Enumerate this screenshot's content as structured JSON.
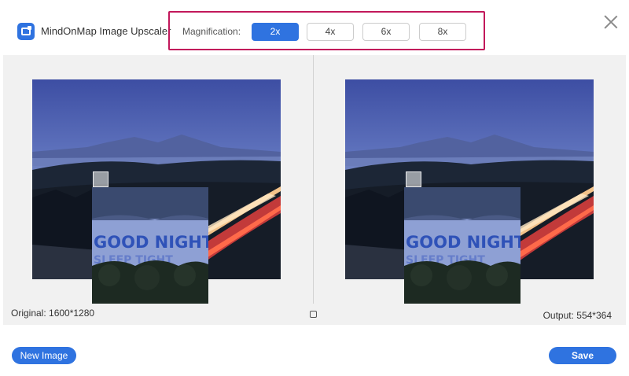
{
  "header": {
    "app_title": "MindOnMap Image Upscaler",
    "magnification_label": "Magnification:",
    "magnification_options": [
      "2x",
      "4x",
      "6x",
      "8x"
    ],
    "selected_magnification": "2x"
  },
  "preview": {
    "original_info": "Original: 1600*1280",
    "output_info": "Output: 554*364",
    "sign_text_line1": "GOOD NIGHT",
    "sign_text_line2": "SLEEP TIGHT"
  },
  "footer": {
    "new_image_label": "New Image",
    "save_label": "Save"
  },
  "colors": {
    "accent": "#2f73e0",
    "highlight_border": "#c2185b",
    "preview_bg": "#f1f1f1"
  },
  "icons": [
    "app-logo-icon",
    "close-icon",
    "compare-toggle-icon"
  ]
}
